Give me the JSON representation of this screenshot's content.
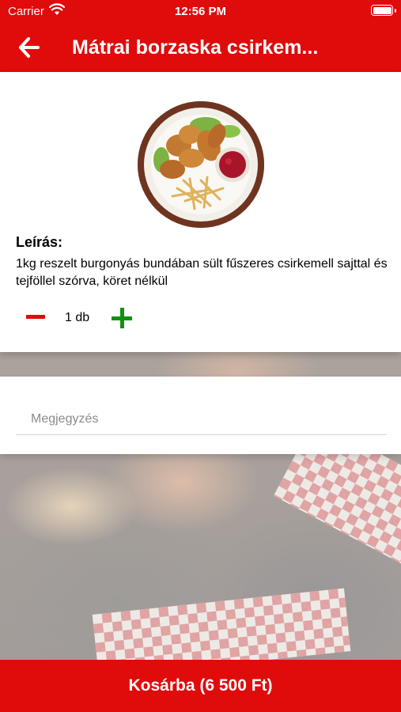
{
  "status_bar": {
    "carrier": "Carrier",
    "time": "12:56 PM",
    "icons": [
      "wifi-icon",
      "battery-icon"
    ]
  },
  "nav": {
    "back_icon": "arrow-left-icon",
    "title": "Mátrai borzaska csirkem..."
  },
  "product": {
    "image": "fried-chicken-dish-photo",
    "description_title": "Leírás:",
    "description": "1kg reszelt burgonyás bundában sült fűszeres csirkemell sajttal és tejföllel szórva, köret nélkül",
    "quantity_label": "1 db",
    "minus_icon": "minus-icon",
    "plus_icon": "plus-icon"
  },
  "note": {
    "placeholder": "Megjegyzés",
    "value": ""
  },
  "cart_button": {
    "label": "Kosárba (6 500 Ft)"
  },
  "colors": {
    "primary": "#e00b0b",
    "plus": "#119011",
    "minus": "#e00b0b"
  }
}
